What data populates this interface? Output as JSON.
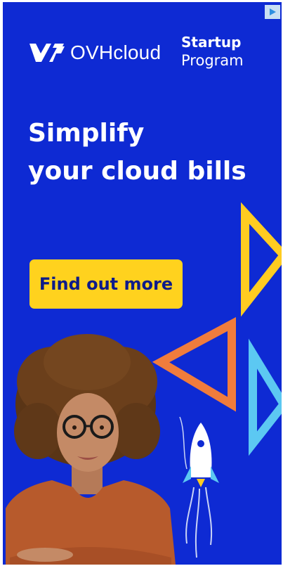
{
  "ad": {
    "brand_name": "OVHcloud",
    "program_line1": "Startup",
    "program_line2": "Program",
    "headline_line1": "Simplify",
    "headline_line2": "your cloud bills",
    "cta_label": "Find out more"
  },
  "icons": {
    "logo": "ovhcloud-logo-icon",
    "adchoices": "play-triangle-icon",
    "decor": [
      "yellow-triangle-icon",
      "orange-triangle-icon",
      "light-blue-triangle-icon",
      "rocket-icon"
    ],
    "photo": "woman-with-glasses-image"
  },
  "colors": {
    "background": "#0e2ad3",
    "cta": "#ffd21e",
    "cta_text": "#0d1b8a",
    "triangle_yellow": "#ffcc21",
    "triangle_orange": "#f07c3c",
    "triangle_blue": "#5cc8f2"
  }
}
